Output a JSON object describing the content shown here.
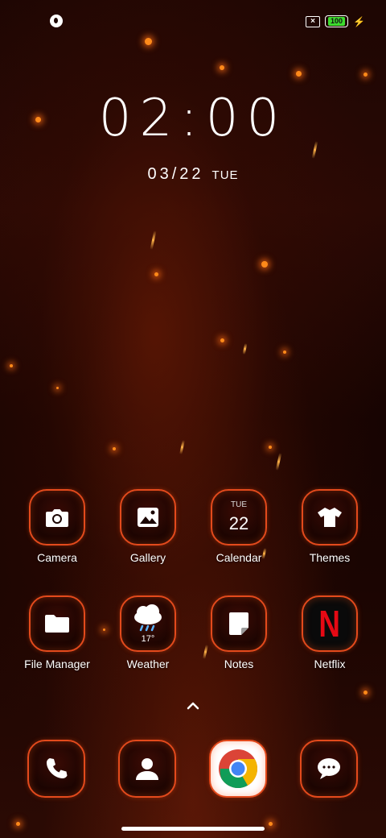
{
  "status_bar": {
    "battery": "100",
    "left_icon": "notification-icon",
    "right_icons": [
      "no-sim-icon",
      "battery-icon",
      "charging-bolt-icon"
    ]
  },
  "lockclock": {
    "time": "02:00",
    "date": "03/22",
    "weekday": "TUE"
  },
  "apps_row1": [
    {
      "label": "Camera",
      "icon": "camera-icon"
    },
    {
      "label": "Gallery",
      "icon": "gallery-icon"
    },
    {
      "label": "Calendar",
      "icon": "calendar-icon",
      "dow": "TUE",
      "day": "22"
    },
    {
      "label": "Themes",
      "icon": "tshirt-icon"
    }
  ],
  "apps_row2": [
    {
      "label": "File Manager",
      "icon": "folder-icon"
    },
    {
      "label": "Weather",
      "icon": "weather-icon",
      "temp": "17°"
    },
    {
      "label": "Notes",
      "icon": "note-icon"
    },
    {
      "label": "Netflix",
      "icon": "netflix-icon",
      "glyph": "N"
    }
  ],
  "dock": [
    {
      "icon": "phone-icon"
    },
    {
      "icon": "contacts-icon"
    },
    {
      "icon": "chrome-icon"
    },
    {
      "icon": "messages-icon"
    }
  ],
  "colors": {
    "accent": "#e34a1c",
    "battery_fill": "#3ddc2f",
    "netflix_red": "#e50914"
  }
}
